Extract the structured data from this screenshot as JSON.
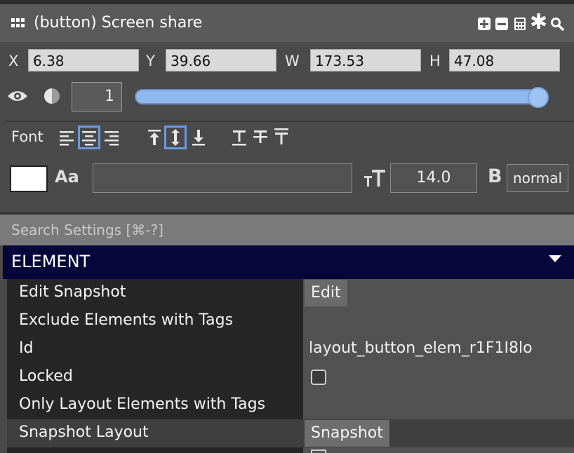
{
  "titlebar": {
    "title": "(button) Screen share",
    "icons": [
      "grid-icon",
      "plus-square-icon",
      "minus-square-icon",
      "calculator-icon",
      "asterisk-icon",
      "search-icon"
    ]
  },
  "geometry": {
    "x_label": "X",
    "x_value": "6.38",
    "y_label": "Y",
    "y_value": "39.66",
    "w_label": "W",
    "w_value": "173.53",
    "h_label": "H",
    "h_value": "47.08"
  },
  "visibility": {
    "opacity_value": "1",
    "slider_level": 1.0
  },
  "font": {
    "label": "Font",
    "selected_h_align": "center",
    "selected_v_align": "middle",
    "color": "#ffffff",
    "font_family_value": "",
    "size_value": "14.0",
    "weight_value": "normal"
  },
  "settings": {
    "search_placeholder": "Search Settings [⌘-?]"
  },
  "element": {
    "header": "ELEMENT",
    "rows": [
      {
        "label": "Edit Snapshot",
        "value": "Edit"
      },
      {
        "label": "Exclude Elements with Tags",
        "value": ""
      },
      {
        "label": "Id",
        "value": "layout_button_elem_r1F1I8lo"
      },
      {
        "label": "Locked",
        "value": ""
      },
      {
        "label": "Only Layout Elements with Tags",
        "value": ""
      },
      {
        "label": "Snapshot Layout",
        "value": "Snapshot"
      }
    ]
  },
  "colors": {
    "header_bg": "#06063a",
    "slider_accent": "#8fb8ee",
    "selected_outline": "#6a9ae4"
  }
}
